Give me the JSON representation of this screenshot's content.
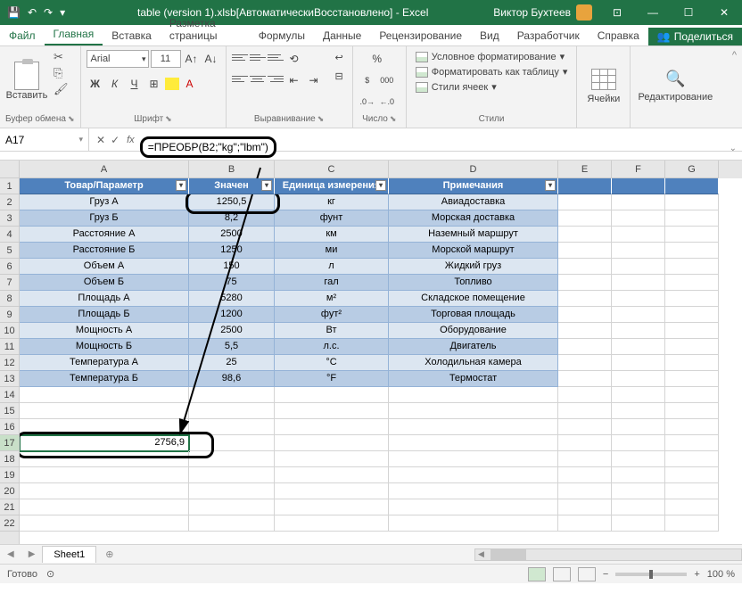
{
  "titlebar": {
    "title": "table (version 1).xlsb[АвтоматическиВосстановлено] - Excel",
    "user": "Виктор Бухтеев"
  },
  "tabs": {
    "file": "Файл",
    "home": "Главная",
    "insert": "Вставка",
    "pagelayout": "Разметка страницы",
    "formulas": "Формулы",
    "data": "Данные",
    "review": "Рецензирование",
    "view": "Вид",
    "developer": "Разработчик",
    "help": "Справка",
    "share": "Поделиться"
  },
  "ribbon": {
    "clipboard": "Буфер обмена",
    "paste": "Вставить",
    "font_group": "Шрифт",
    "font_name": "Arial",
    "font_size": "11",
    "bold": "Ж",
    "italic": "К",
    "underline": "Ч",
    "align_group": "Выравнивание",
    "number_group": "Число",
    "styles_group": "Стили",
    "cond_fmt": "Условное форматирование",
    "table_fmt": "Форматировать как таблицу",
    "cell_styles": "Стили ячеек",
    "cells_group": "Ячейки",
    "edit_group": "Редактирование"
  },
  "namebox": "A17",
  "formula": "=ПРЕОБР(B2;\"kg\";\"lbm\")",
  "columns": [
    "A",
    "B",
    "C",
    "D",
    "E",
    "F",
    "G"
  ],
  "headers": [
    "Товар/Параметр",
    "Значен",
    "Единица измерения",
    "Примечания"
  ],
  "chart_data": {
    "type": "table",
    "columns": [
      "Товар/Параметр",
      "Значение",
      "Единица измерения",
      "Примечания"
    ],
    "rows": [
      [
        "Груз А",
        "1250,5",
        "кг",
        "Авиадоставка"
      ],
      [
        "Груз Б",
        "8,2",
        "фунт",
        "Морская доставка"
      ],
      [
        "Расстояние А",
        "2500",
        "км",
        "Наземный маршрут"
      ],
      [
        "Расстояние Б",
        "1250",
        "ми",
        "Морской маршрут"
      ],
      [
        "Объем А",
        "150",
        "л",
        "Жидкий груз"
      ],
      [
        "Объем Б",
        "75",
        "гал",
        "Топливо"
      ],
      [
        "Площадь А",
        "5280",
        "м²",
        "Складское помещение"
      ],
      [
        "Площадь Б",
        "1200",
        "фут²",
        "Торговая площадь"
      ],
      [
        "Мощность А",
        "2500",
        "Вт",
        "Оборудование"
      ],
      [
        "Мощность Б",
        "5,5",
        "л.с.",
        "Двигатель"
      ],
      [
        "Температура А",
        "25",
        "°C",
        "Холодильная камера"
      ],
      [
        "Температура Б",
        "98,6",
        "°F",
        "Термостат"
      ]
    ]
  },
  "result_cell": "2756,9",
  "sheet_tab": "Sheet1",
  "status": {
    "ready": "Готово",
    "zoom": "100 %"
  }
}
